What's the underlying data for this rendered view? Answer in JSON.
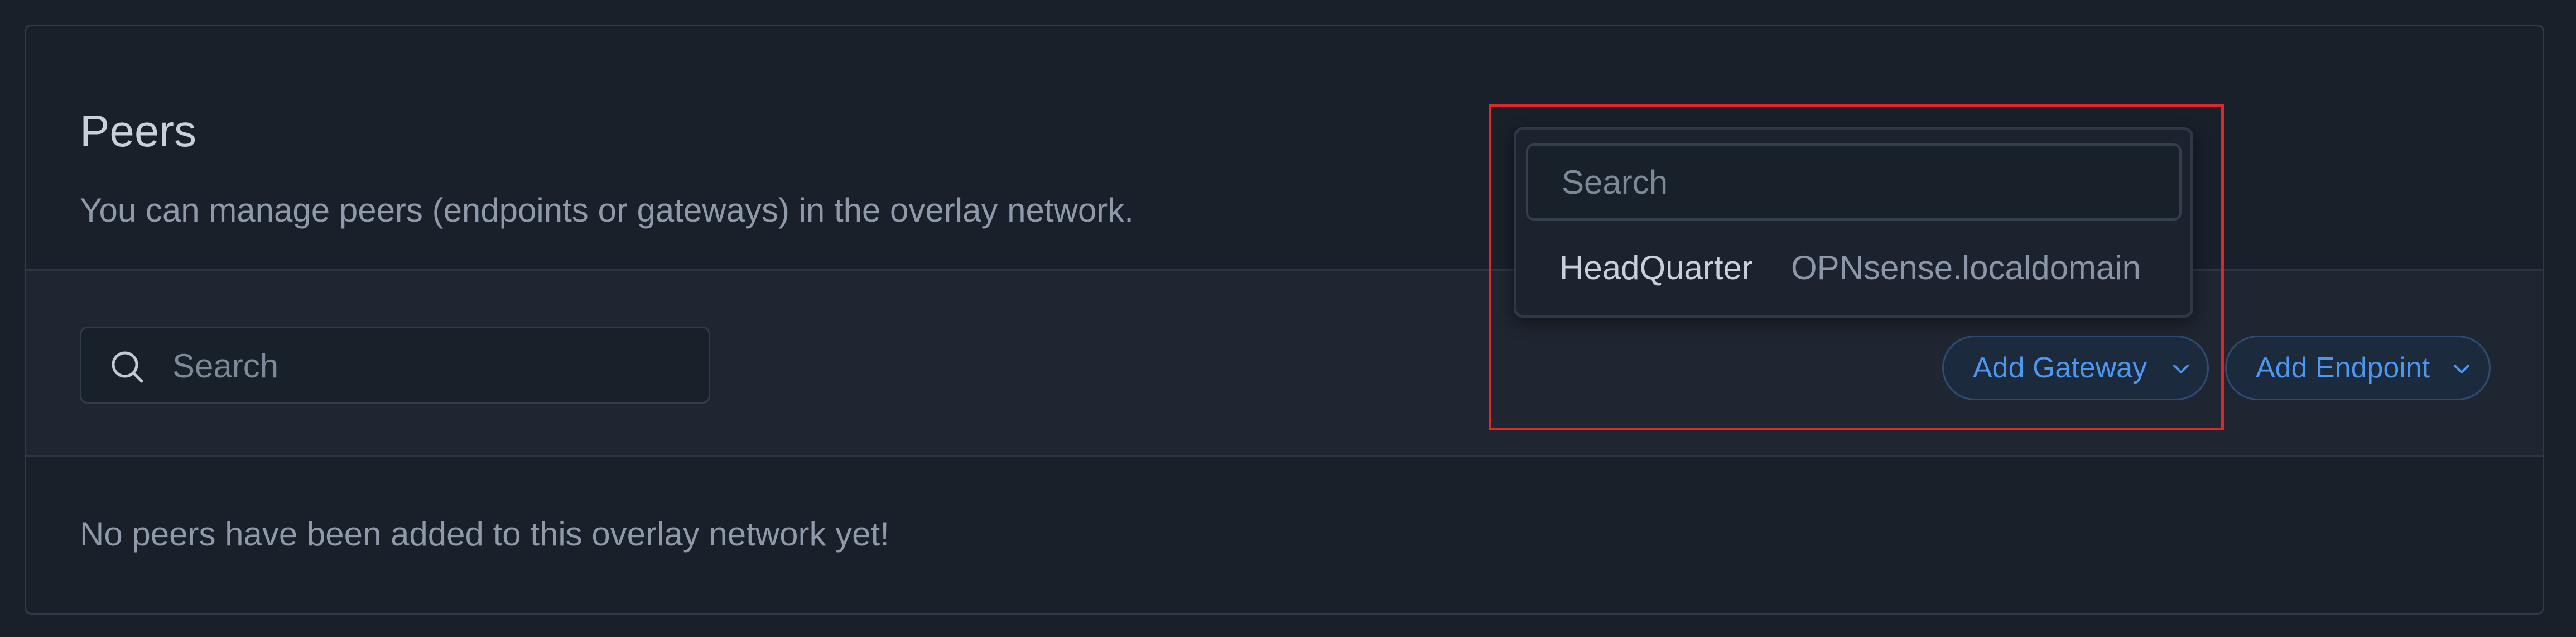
{
  "section": {
    "title": "Peers",
    "subtitle": "You can manage peers (endpoints or gateways) in the overlay network."
  },
  "toolbar": {
    "search_placeholder": "Search",
    "add_gateway_label": "Add Gateway",
    "add_endpoint_label": "Add Endpoint"
  },
  "empty_state": {
    "message": "No peers have been added to this overlay network yet!"
  },
  "gateway_dropdown": {
    "search_placeholder": "Search",
    "items": [
      {
        "name": "HeadQuarter",
        "host": "OPNsense.localdomain"
      }
    ]
  },
  "icons": {
    "search": "search-icon",
    "chevron": "chevron-down-icon"
  },
  "colors": {
    "background": "#19202a",
    "toolbar_background": "#1f2631",
    "accent": "#4d97ef",
    "highlight": "#e0282c"
  }
}
